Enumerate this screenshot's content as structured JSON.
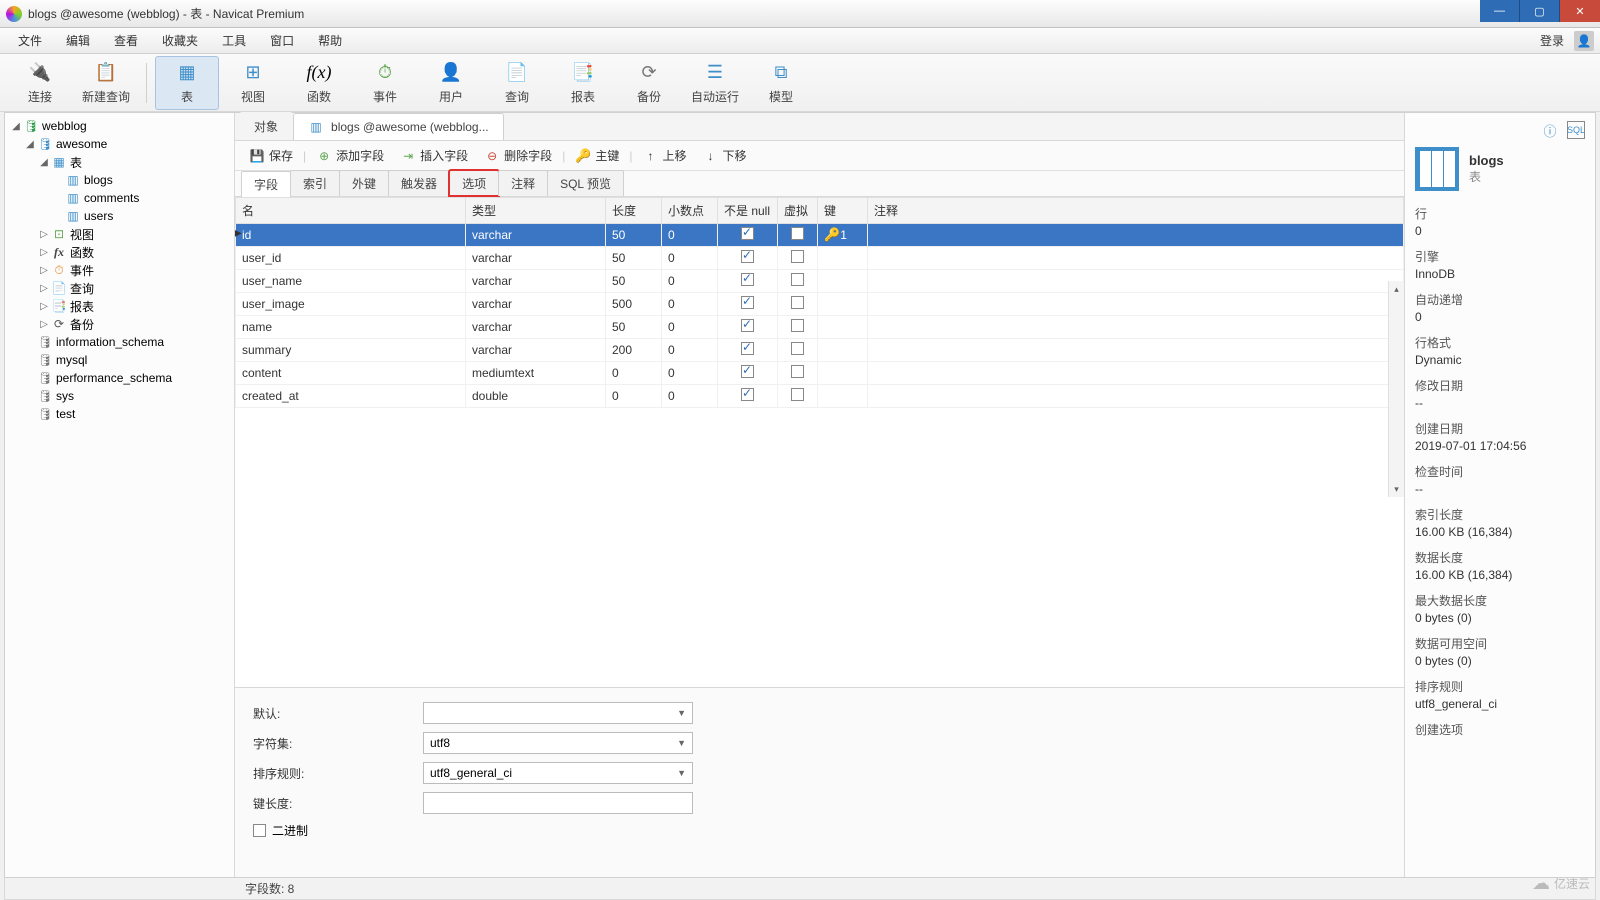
{
  "window": {
    "title": "blogs @awesome (webblog) - 表 - Navicat Premium"
  },
  "menubar": {
    "items": [
      "文件",
      "编辑",
      "查看",
      "收藏夹",
      "工具",
      "窗口",
      "帮助"
    ],
    "login": "登录"
  },
  "toolbar": {
    "items": [
      {
        "label": "连接",
        "icon": "plug"
      },
      {
        "label": "新建查询",
        "icon": "query-new"
      },
      {
        "label": "表",
        "icon": "table",
        "active": true
      },
      {
        "label": "视图",
        "icon": "view"
      },
      {
        "label": "函数",
        "icon": "fx"
      },
      {
        "label": "事件",
        "icon": "event"
      },
      {
        "label": "用户",
        "icon": "user"
      },
      {
        "label": "查询",
        "icon": "query"
      },
      {
        "label": "报表",
        "icon": "report"
      },
      {
        "label": "备份",
        "icon": "backup"
      },
      {
        "label": "自动运行",
        "icon": "auto"
      },
      {
        "label": "模型",
        "icon": "model"
      }
    ]
  },
  "tree": {
    "db": "webblog",
    "schema": "awesome",
    "tables_folder": "表",
    "tables": [
      "blogs",
      "comments",
      "users"
    ],
    "items_after": [
      {
        "label": "视图",
        "ico": "view"
      },
      {
        "label": "函数",
        "ico": "fx"
      },
      {
        "label": "事件",
        "ico": "event"
      },
      {
        "label": "查询",
        "ico": "query"
      },
      {
        "label": "报表",
        "ico": "report"
      },
      {
        "label": "备份",
        "ico": "backup"
      }
    ],
    "other_schemas": [
      "information_schema",
      "mysql",
      "performance_schema",
      "sys",
      "test"
    ]
  },
  "doc_tabs": {
    "obj": "对象",
    "table_tab": "blogs @awesome (webblog..."
  },
  "subtoolbar": {
    "save": "保存",
    "add_field": "添加字段",
    "insert_field": "插入字段",
    "delete_field": "删除字段",
    "pkey": "主键",
    "move_up": "上移",
    "move_down": "下移"
  },
  "inner_tabs": [
    "字段",
    "索引",
    "外键",
    "触发器",
    "选项",
    "注释",
    "SQL 预览"
  ],
  "grid": {
    "headers": {
      "name": "名",
      "type": "类型",
      "len": "长度",
      "dec": "小数点",
      "nn": "不是 null",
      "virt": "虚拟",
      "key": "键",
      "comment": "注释"
    },
    "rows": [
      {
        "name": "id",
        "type": "varchar",
        "len": "50",
        "dec": "0",
        "nn": true,
        "virt": false,
        "key": "1",
        "selected": true
      },
      {
        "name": "user_id",
        "type": "varchar",
        "len": "50",
        "dec": "0",
        "nn": true,
        "virt": false,
        "key": ""
      },
      {
        "name": "user_name",
        "type": "varchar",
        "len": "50",
        "dec": "0",
        "nn": true,
        "virt": false,
        "key": ""
      },
      {
        "name": "user_image",
        "type": "varchar",
        "len": "500",
        "dec": "0",
        "nn": true,
        "virt": false,
        "key": ""
      },
      {
        "name": "name",
        "type": "varchar",
        "len": "50",
        "dec": "0",
        "nn": true,
        "virt": false,
        "key": ""
      },
      {
        "name": "summary",
        "type": "varchar",
        "len": "200",
        "dec": "0",
        "nn": true,
        "virt": false,
        "key": ""
      },
      {
        "name": "content",
        "type": "mediumtext",
        "len": "0",
        "dec": "0",
        "nn": true,
        "virt": false,
        "key": ""
      },
      {
        "name": "created_at",
        "type": "double",
        "len": "0",
        "dec": "0",
        "nn": true,
        "virt": false,
        "key": ""
      }
    ]
  },
  "form": {
    "default_lbl": "默认:",
    "default_val": "",
    "charset_lbl": "字符集:",
    "charset_val": "utf8",
    "collation_lbl": "排序规则:",
    "collation_val": "utf8_general_ci",
    "keylen_lbl": "键长度:",
    "keylen_val": "",
    "binary_lbl": "二进制"
  },
  "rpanel": {
    "title": "blogs",
    "subtitle": "表",
    "fields": [
      {
        "k": "行",
        "v": "0"
      },
      {
        "k": "引擎",
        "v": "InnoDB"
      },
      {
        "k": "自动递增",
        "v": "0"
      },
      {
        "k": "行格式",
        "v": "Dynamic"
      },
      {
        "k": "修改日期",
        "v": "--"
      },
      {
        "k": "创建日期",
        "v": "2019-07-01 17:04:56"
      },
      {
        "k": "检查时间",
        "v": "--"
      },
      {
        "k": "索引长度",
        "v": "16.00 KB (16,384)"
      },
      {
        "k": "数据长度",
        "v": "16.00 KB (16,384)"
      },
      {
        "k": "最大数据长度",
        "v": "0 bytes (0)"
      },
      {
        "k": "数据可用空间",
        "v": "0 bytes (0)"
      },
      {
        "k": "排序规则",
        "v": "utf8_general_ci"
      },
      {
        "k": "创建选项",
        "v": ""
      }
    ]
  },
  "statusbar": {
    "fields": "字段数: 8"
  },
  "watermark": "亿速云"
}
